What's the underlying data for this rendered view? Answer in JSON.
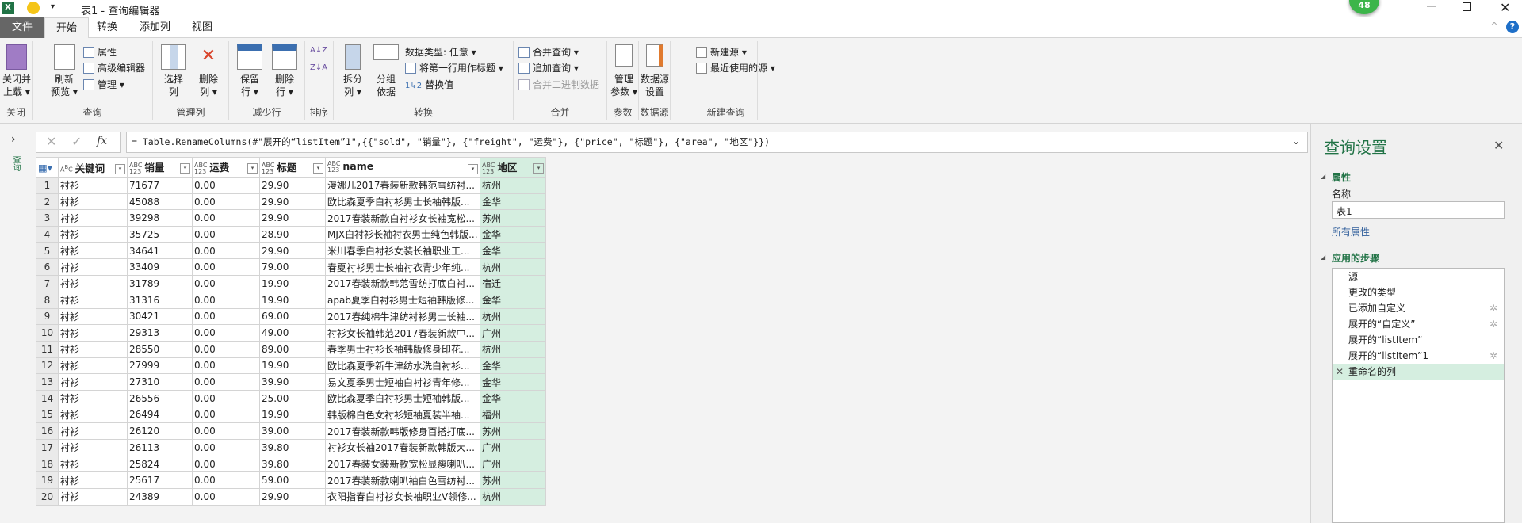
{
  "titlebar": {
    "title": "表1 - 查询编辑器",
    "badge": "48"
  },
  "tabs": [
    {
      "label": "文件"
    },
    {
      "label": "开始"
    },
    {
      "label": "转换"
    },
    {
      "label": "添加列"
    },
    {
      "label": "视图"
    }
  ],
  "ribbon": {
    "close": {
      "btn1": "关闭并",
      "btn2": "上载",
      "group": "关闭"
    },
    "query": {
      "refresh1": "刷新",
      "refresh2": "预览",
      "properties": "属性",
      "advanced": "高级编辑器",
      "manage": "管理",
      "group": "查询"
    },
    "columns": {
      "choose1": "选择",
      "choose2": "列",
      "remove1": "删除",
      "remove2": "列",
      "group": "管理列"
    },
    "rows": {
      "keep1": "保留",
      "keep2": "行",
      "remove1": "删除",
      "remove2": "行",
      "group": "减少行"
    },
    "sort": {
      "group": "排序"
    },
    "transform": {
      "split1": "拆分",
      "split2": "列",
      "groupby1": "分组",
      "groupby2": "依据",
      "datatype": "数据类型: 任意",
      "firstrow": "将第一行用作标题",
      "replace": "替换值",
      "group": "转换"
    },
    "combine": {
      "merge": "合并查询",
      "append": "追加查询",
      "binary": "合并二进制数据",
      "group": "合并"
    },
    "params": {
      "manage1": "管理",
      "manage2": "参数",
      "group": "参数"
    },
    "datasource": {
      "settings1": "数据源",
      "settings2": "设置",
      "group": "数据源"
    },
    "newquery": {
      "newsource": "新建源",
      "recent": "最近使用的源",
      "group": "新建查询"
    }
  },
  "leftstrip": {
    "label": "查询"
  },
  "formula": {
    "fx": "fx",
    "text": "= Table.RenameColumns(#\"展开的“listItem”1\",{{\"sold\", \"销量\"}, {\"freight\", \"运费\"}, {\"price\", \"标题\"}, {\"area\", \"地区\"}})"
  },
  "table": {
    "columns": [
      {
        "name": "关键词",
        "type": "ABC"
      },
      {
        "name": "销量",
        "type": "ABC123"
      },
      {
        "name": "运费",
        "type": "ABC123"
      },
      {
        "name": "标题",
        "type": "ABC123"
      },
      {
        "name": "name",
        "type": "ABC123"
      },
      {
        "name": "地区",
        "type": "ABC123"
      }
    ],
    "rows": [
      [
        "衬衫",
        "71677",
        "0.00",
        "29.90",
        "漫娜儿2017春装新款韩范雪纺衬...",
        "杭州"
      ],
      [
        "衬衫",
        "45088",
        "0.00",
        "29.90",
        "欧比森夏季白衬衫男士长袖韩版...",
        "金华"
      ],
      [
        "衬衫",
        "39298",
        "0.00",
        "29.90",
        "2017春装新款白衬衫女长袖宽松...",
        "苏州"
      ],
      [
        "衬衫",
        "35725",
        "0.00",
        "28.90",
        "MJX白衬衫长袖衬衣男士纯色韩版...",
        "金华"
      ],
      [
        "衬衫",
        "34641",
        "0.00",
        "29.90",
        "米川春季白衬衫女装长袖职业工...",
        "金华"
      ],
      [
        "衬衫",
        "33409",
        "0.00",
        "79.00",
        "春夏衬衫男士长袖衬衣青少年纯...",
        "杭州"
      ],
      [
        "衬衫",
        "31789",
        "0.00",
        "19.90",
        "2017春装新款韩范雪纺打底白衬...",
        "宿迁"
      ],
      [
        "衬衫",
        "31316",
        "0.00",
        "19.90",
        "apab夏季白衬衫男士短袖韩版修...",
        "金华"
      ],
      [
        "衬衫",
        "30421",
        "0.00",
        "69.00",
        "2017春纯棉牛津纺衬衫男士长袖...",
        "杭州"
      ],
      [
        "衬衫",
        "29313",
        "0.00",
        "49.00",
        "衬衫女长袖韩范2017春装新款中...",
        "广州"
      ],
      [
        "衬衫",
        "28550",
        "0.00",
        "89.00",
        "春季男士衬衫长袖韩版修身印花...",
        "杭州"
      ],
      [
        "衬衫",
        "27999",
        "0.00",
        "19.90",
        "欧比森夏季新牛津纺水洗白衬衫...",
        "金华"
      ],
      [
        "衬衫",
        "27310",
        "0.00",
        "39.90",
        "易文夏季男士短袖白衬衫青年修...",
        "金华"
      ],
      [
        "衬衫",
        "26556",
        "0.00",
        "25.00",
        "欧比森夏季白衬衫男士短袖韩版...",
        "金华"
      ],
      [
        "衬衫",
        "26494",
        "0.00",
        "19.90",
        "韩版棉白色女衬衫短袖夏装半袖...",
        "福州"
      ],
      [
        "衬衫",
        "26120",
        "0.00",
        "39.00",
        "2017春装新款韩版修身百搭打底...",
        "苏州"
      ],
      [
        "衬衫",
        "26113",
        "0.00",
        "39.80",
        "衬衫女长袖2017春装新款韩版大...",
        "广州"
      ],
      [
        "衬衫",
        "25824",
        "0.00",
        "39.80",
        "2017春装女装新款宽松显瘦喇叭...",
        "广州"
      ],
      [
        "衬衫",
        "25617",
        "0.00",
        "59.00",
        "2017春装新款喇叭袖白色雪纺衬...",
        "苏州"
      ],
      [
        "衬衫",
        "24389",
        "0.00",
        "29.90",
        "衣阳指春白衬衫女长袖职业V领修...",
        "杭州"
      ]
    ]
  },
  "panel": {
    "title": "查询设置",
    "props_header": "属性",
    "name_label": "名称",
    "name_value": "表1",
    "all_props": "所有属性",
    "steps_header": "应用的步骤",
    "steps": [
      {
        "label": "源",
        "gear": false
      },
      {
        "label": "更改的类型",
        "gear": false
      },
      {
        "label": "已添加自定义",
        "gear": true
      },
      {
        "label": "展开的“自定义”",
        "gear": true
      },
      {
        "label": "展开的“listItem”",
        "gear": false
      },
      {
        "label": "展开的“listItem”1",
        "gear": true
      },
      {
        "label": "重命名的列",
        "gear": false,
        "selected": true
      }
    ]
  },
  "colors": {
    "accent": "#217346",
    "selected_column": "#d5eee0",
    "file_tab": "#666666"
  }
}
